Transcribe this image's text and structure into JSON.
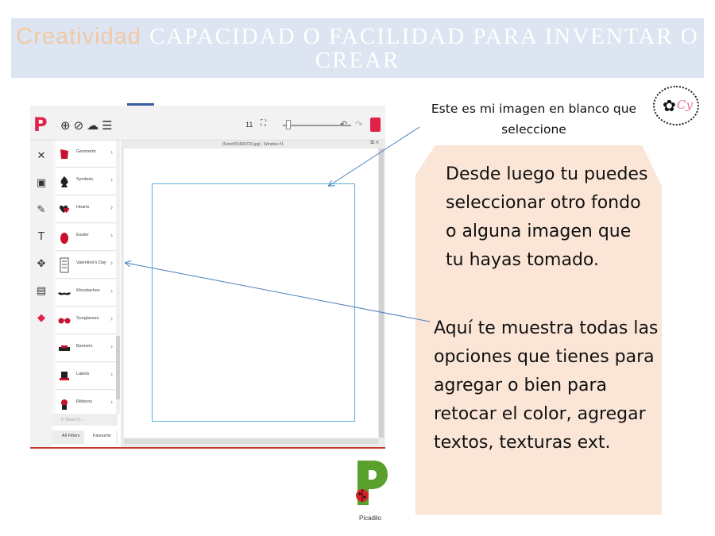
{
  "title": {
    "highlight": "Creatividad",
    "rest": "capacidad o facilidad para inventar o crear"
  },
  "app": {
    "zoom_value": "11",
    "window_title": "[Fotor051665720.jpg] - Window #1",
    "categories": [
      {
        "label": "Geometric",
        "icon": "red-shape-icon"
      },
      {
        "label": "Symbols",
        "icon": "spade-icon"
      },
      {
        "label": "Hearts",
        "icon": "hearts-icon"
      },
      {
        "label": "Easter",
        "icon": "egg-icon"
      },
      {
        "label": "Valentine's Day",
        "icon": "valentine-icon"
      },
      {
        "label": "Moustaches",
        "icon": "moustache-icon"
      },
      {
        "label": "Sunglasses",
        "icon": "sunglasses-icon"
      },
      {
        "label": "Banners",
        "icon": "banner-icon"
      },
      {
        "label": "Labels",
        "icon": "label-icon"
      },
      {
        "label": "Ribbons",
        "icon": "ribbon-icon"
      }
    ],
    "search_placeholder": "Search...",
    "tabs": [
      "All Filters",
      "Favourite"
    ],
    "accent": "#e0224b"
  },
  "notes": {
    "top": "Este es mi imagen en blanco que seleccione",
    "callout1": "Desde luego tu puedes seleccionar otro fondo o alguna imagen que tu hayas tomado.",
    "callout2": "Aquí te muestra todas las opciones que tienes para agregar o bien para retocar el color, agregar textos, texturas ext."
  },
  "seal_text": "Cy",
  "desktop_icon": {
    "label": "Picadilo"
  }
}
